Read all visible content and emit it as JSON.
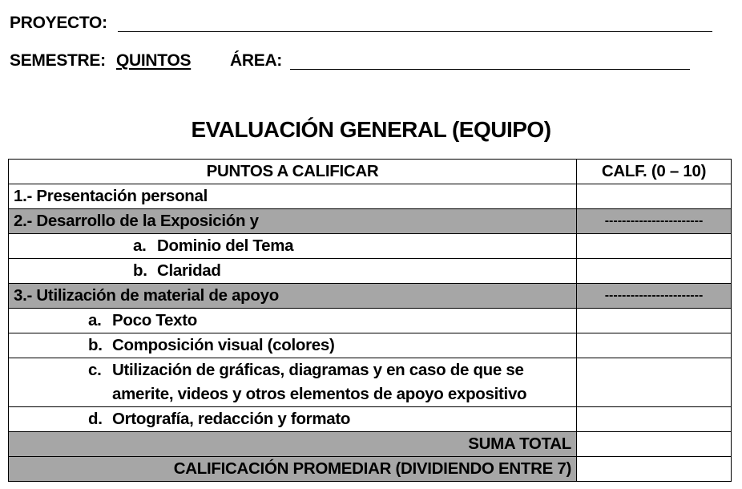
{
  "header": {
    "proyecto_label": "PROYECTO:",
    "semestre_label": "SEMESTRE:",
    "semestre_value": "QUINTOS",
    "area_label": "ÁREA:"
  },
  "title": "EVALUACIÓN GENERAL (EQUIPO)",
  "table": {
    "col1_header": "PUNTOS A CALIFICAR",
    "col2_header": "CALF. (0 – 10)",
    "rows": [
      {
        "text": "1.- Presentación personal"
      },
      {
        "text": "2.- Desarrollo de la Exposición y",
        "score": "-----------------------"
      },
      {
        "marker": "a.",
        "text": "Dominio del Tema"
      },
      {
        "marker": "b.",
        "text": "Claridad"
      },
      {
        "text": "3.- Utilización de material de apoyo",
        "score": "-----------------------"
      },
      {
        "marker": "a.",
        "text": "Poco Texto"
      },
      {
        "marker": "b.",
        "text": "Composición visual (colores)"
      },
      {
        "marker": "c.",
        "text_line1": "Utilización de gráficas, diagramas y en caso de que se",
        "text_line2": "amerite, videos y otros elementos de apoyo expositivo"
      },
      {
        "marker": "d.",
        "text": "Ortografía, redacción y formato"
      }
    ],
    "suma_total": "SUMA TOTAL",
    "calificacion_promediar": "CALIFICACIÓN PROMEDIAR (DIVIDIENDO ENTRE 7)"
  },
  "colors": {
    "shade": "#a6a6a6"
  }
}
